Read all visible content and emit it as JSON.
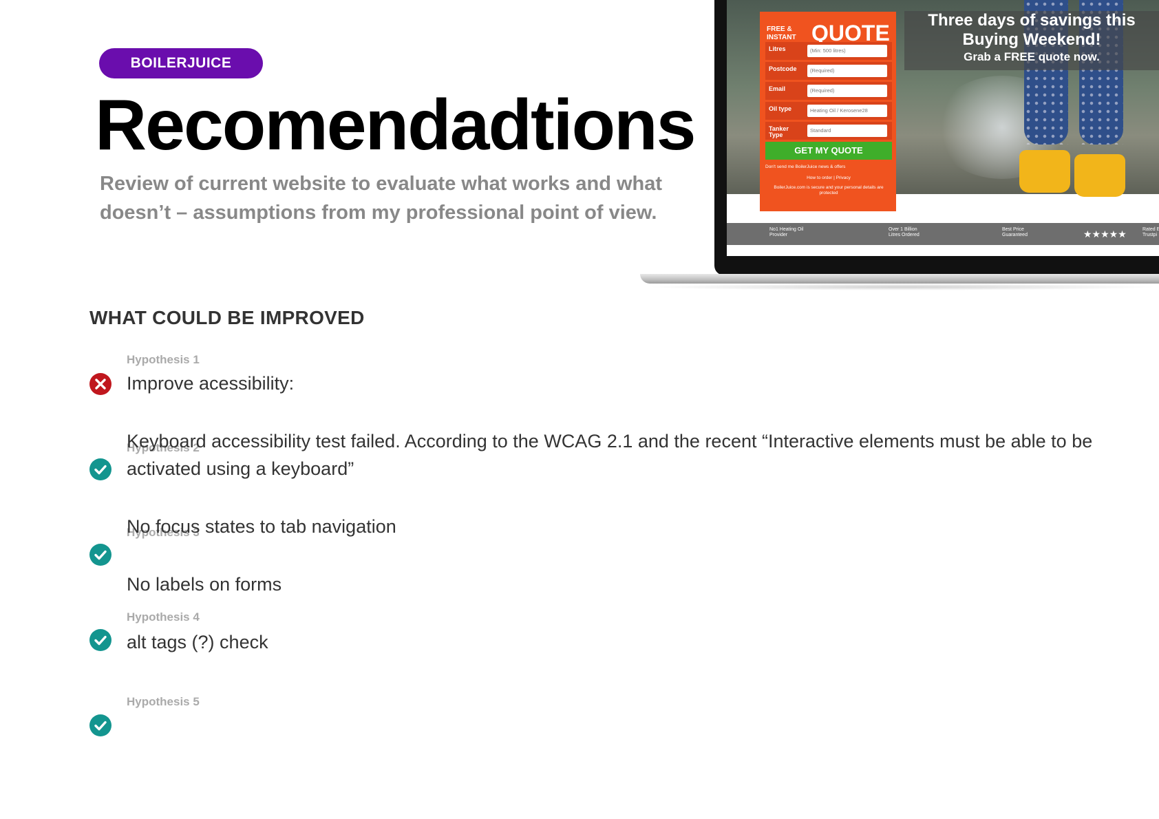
{
  "badge": "BOILERJUICE",
  "title": "Recomendadtions",
  "subtitle": "Review of current website to evaluate what works and what doesn’t – assumptions from my professional point of view.",
  "section_heading": "WHAT COULD BE IMPROVED",
  "colors": {
    "badge": "#6a0dad",
    "fail": "#c0171e",
    "pass": "#13958f"
  },
  "hypotheses": [
    {
      "label": "Hypothesis 1",
      "status": "fail",
      "icon": "x-circle-icon"
    },
    {
      "label": "Hypothesis 2",
      "status": "pass",
      "icon": "check-circle-icon"
    },
    {
      "label": "Hypothesis 3",
      "status": "pass",
      "icon": "check-circle-icon"
    },
    {
      "label": "Hypothesis 4",
      "status": "pass",
      "icon": "check-circle-icon"
    },
    {
      "label": "Hypothesis 5",
      "status": "pass",
      "icon": "check-circle-icon"
    }
  ],
  "body_lines": [
    "Improve acessibility:",
    "Keyboard accessibility test failed. According to the WCAG 2.1 and the recent “Interactive elements must be able to be",
    "activated using a keyboard”",
    "No focus states to tab navigation",
    "No labels on forms",
    "alt tags (?) check"
  ],
  "mockup": {
    "quote_small": "FREE & INSTANT",
    "quote_big": "QUOTE",
    "fields": [
      {
        "label": "Litres",
        "value": "(Min: 500 litres)"
      },
      {
        "label": "Postcode",
        "value": "(Required)"
      },
      {
        "label": "Email",
        "value": "(Required)"
      },
      {
        "label": "Oil type",
        "value": "Heating Oil / Kerosene28"
      },
      {
        "label": "Tanker Type",
        "value": "Standard"
      }
    ],
    "button": "GET MY QUOTE",
    "optout": "Don't send me BoilerJuice news & offers",
    "links": "How to order | Privacy",
    "secure": "BoilerJuice.com is secure and your personal details are protected",
    "promo_line1": "Three days of savings this",
    "promo_line2": "Buying Weekend!",
    "promo_line3": "Grab a FREE quote now.",
    "trust": [
      "No1 Heating Oil Provider",
      "Over 1 Billion Litres Ordered",
      "Best Price Guaranteed",
      "★★★★★",
      "Rated E Trustpi"
    ]
  }
}
